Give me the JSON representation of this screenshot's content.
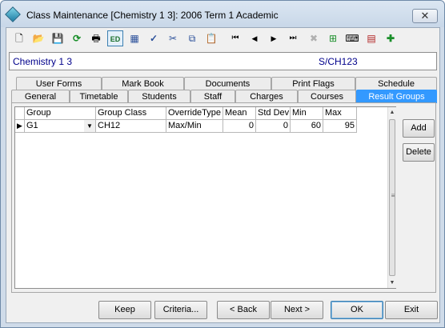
{
  "window": {
    "title": "Class Maintenance  [Chemistry 1 3]:  2006 Term 1 Academic",
    "close_label": "✕"
  },
  "toolbar": {
    "buttons": [
      {
        "name": "new-icon",
        "glyph": "🗋"
      },
      {
        "name": "open-folder-icon",
        "glyph": "📂"
      },
      {
        "name": "save-icon",
        "glyph": "💾"
      },
      {
        "name": "refresh-icon",
        "glyph": "⟳"
      },
      {
        "name": "print-icon",
        "glyph": "🖶"
      },
      {
        "name": "edit-icon",
        "glyph": "ED"
      },
      {
        "name": "calculator-icon",
        "glyph": "▦"
      },
      {
        "name": "spellcheck-icon",
        "glyph": "✓"
      },
      {
        "name": "cut-icon",
        "glyph": "✂"
      },
      {
        "name": "copy-icon",
        "glyph": "⧉"
      },
      {
        "name": "paste-icon",
        "glyph": "📋"
      },
      {
        "name": "first-record-icon",
        "glyph": "⏮"
      },
      {
        "name": "previous-record-icon",
        "glyph": "◀"
      },
      {
        "name": "next-record-icon",
        "glyph": "▶"
      },
      {
        "name": "last-record-icon",
        "glyph": "⏭"
      },
      {
        "name": "delete-icon",
        "glyph": "✖"
      },
      {
        "name": "find-icon",
        "glyph": "⊞"
      },
      {
        "name": "keyboard-icon",
        "glyph": "⌨"
      },
      {
        "name": "grid-export-icon",
        "glyph": "▤"
      },
      {
        "name": "add-task-icon",
        "glyph": "✚"
      }
    ]
  },
  "header": {
    "course_name": "Chemistry 1 3",
    "course_code": "S/CH123"
  },
  "tabs": {
    "row1": [
      "User Forms",
      "Mark Book",
      "Documents",
      "Print Flags",
      "Schedule"
    ],
    "row2": [
      "General",
      "Timetable",
      "Students",
      "Staff",
      "Charges",
      "Courses",
      "Result Groups"
    ],
    "selected": "Result Groups"
  },
  "grid": {
    "columns": [
      "Group",
      "Group Class",
      "OverrideType",
      "Mean",
      "Std Dev",
      "Min",
      "Max"
    ],
    "rows": [
      {
        "indicator": "▶",
        "group": "G1",
        "group_class": "CH12",
        "override_type": "Max/Min",
        "mean": "0",
        "std_dev": "0",
        "min": "60",
        "max": "95"
      }
    ]
  },
  "side_buttons": {
    "add": "Add",
    "delete": "Delete"
  },
  "footer": {
    "keep": "Keep",
    "criteria": "Criteria...",
    "back": "< Back",
    "next": "Next >",
    "ok": "OK",
    "exit": "Exit"
  },
  "colors": {
    "accent": "#3399ff",
    "header_text": "#00008b"
  }
}
